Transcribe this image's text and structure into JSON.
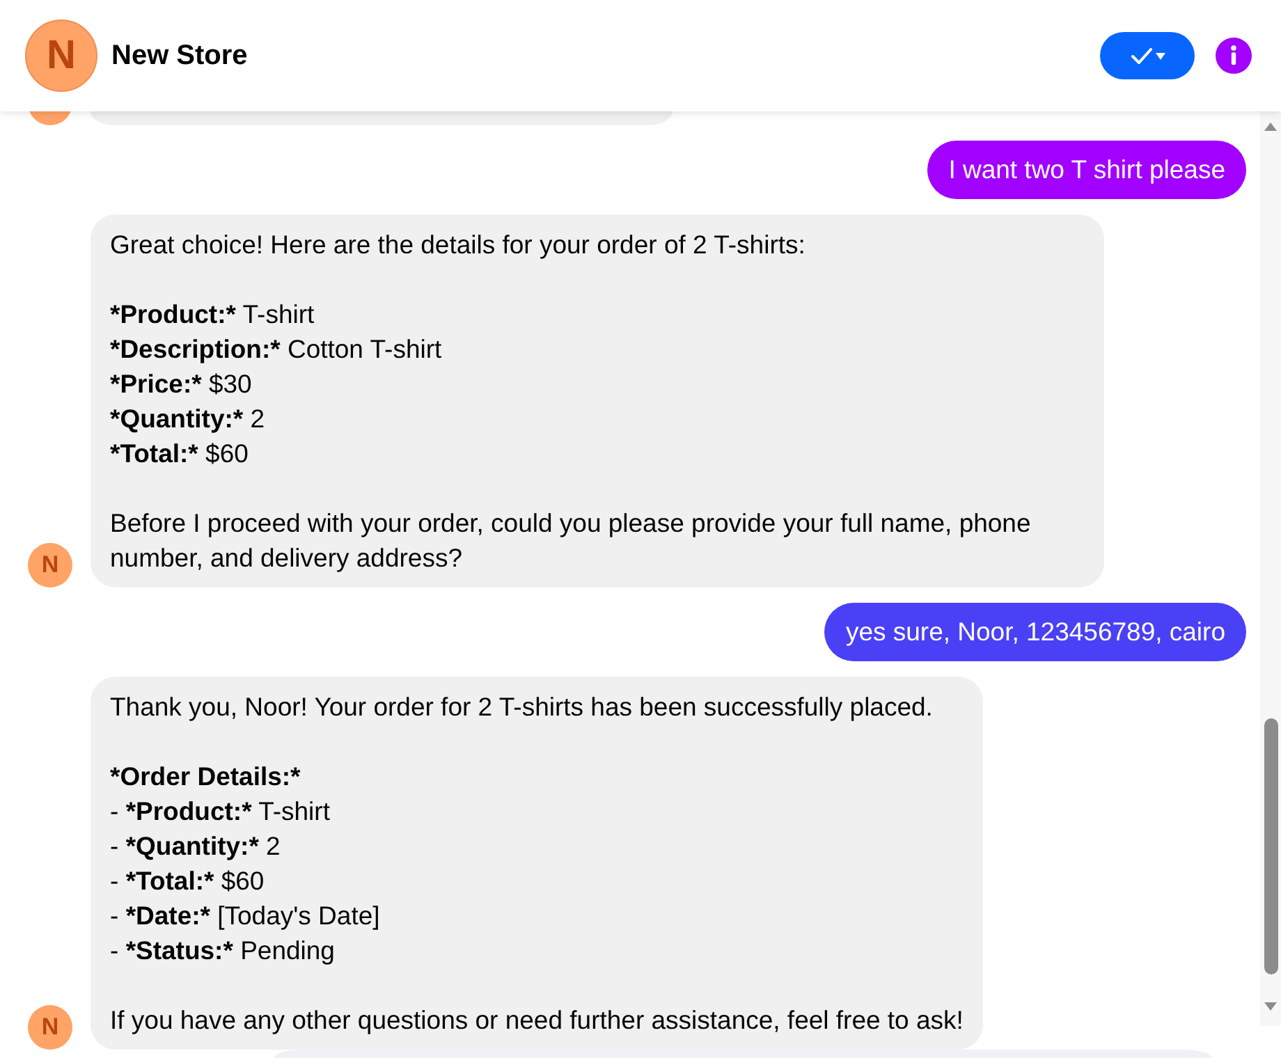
{
  "header": {
    "avatar": "N",
    "title": "New Store"
  },
  "messages": [
    {
      "kind": "incoming"
    },
    {
      "kind": "outgoing",
      "text": "I want two T shirt please",
      "color": "#a200ff"
    },
    {
      "kind": "incoming",
      "avatar": "N",
      "paragraphs": [
        [
          {
            "text": "Great choice! Here are the details for your order of 2 T-shirts:"
          }
        ],
        [
          {
            "label": "*Product:*",
            "text": "T-shirt"
          },
          {
            "label": "*Description:*",
            "text": "Cotton T-shirt"
          },
          {
            "label": "*Price:*",
            "text": "$30"
          },
          {
            "label": "*Quantity:*",
            "text": "2"
          },
          {
            "label": "*Total:*",
            "text": "$60"
          }
        ],
        [
          {
            "text": "Before I proceed with your order, could you please provide your full name, phone number, and delivery address?"
          }
        ]
      ]
    },
    {
      "kind": "outgoing",
      "text": "yes sure, Noor, 123456789, cairo",
      "color": "#4a40f5"
    },
    {
      "kind": "incoming",
      "avatar": "N",
      "paragraphs": [
        [
          {
            "text": "Thank you, Noor! Your order for 2 T-shirts has been successfully placed."
          }
        ],
        [
          {
            "label": "*Order Details:*"
          },
          {
            "bullet": "-",
            "label": "*Product:*",
            "text": "T-shirt"
          },
          {
            "bullet": "-",
            "label": "*Quantity:*",
            "text": "2"
          },
          {
            "bullet": "-",
            "label": "*Total:*",
            "text": "$60"
          },
          {
            "bullet": "-",
            "label": "*Date:*",
            "text": "[Today's Date]"
          },
          {
            "bullet": "-",
            "label": "*Status:*",
            "text": "Pending"
          }
        ],
        [
          {
            "text": "If you have any other questions or need further assistance, feel free to ask!"
          }
        ]
      ]
    }
  ]
}
